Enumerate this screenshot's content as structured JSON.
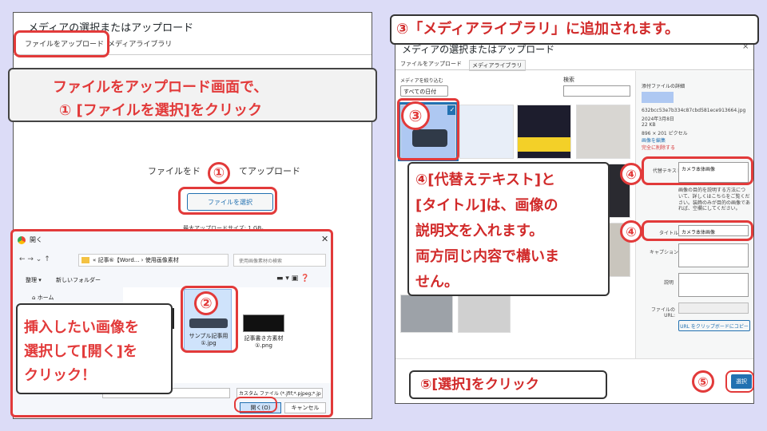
{
  "left": {
    "dialog_title": "メディアの選択またはアップロード",
    "tab_upload": "ファイルをアップロード",
    "tab_library": "メディアライブラリ",
    "callout_line1": "ファイルをアップロード画面で、",
    "callout_line2": "① [ファイルを選択]をクリック",
    "drop_text_a": "ファイルをド",
    "drop_text_b": "てアップロード",
    "step1": "①",
    "select_file_button": "ファイルを選択",
    "max_upload": "最大アップロードサイズ: 1 GB。",
    "open_dialog": {
      "title": "開く",
      "path": "« 記事⑥【Word... › 使用画像素材",
      "search_placeholder": "使用画像素材の検索",
      "organize": "整理 ▾",
      "new_folder": "新しいフォルダー",
      "home": "ホーム",
      "file1": "サンプル記事用 ①.jpg",
      "file2": "記事書き方素材 ①.png",
      "filetype": "カスタム ファイル (*.jfif;*.pjpeg;*.jp",
      "open_button": "開く(O)",
      "cancel_button": "キャンセル"
    },
    "step2": "②",
    "callout_select_l1": "挿入したい画像を",
    "callout_select_l2": "選択して[開く]を",
    "callout_select_l3": "クリック！"
  },
  "right": {
    "banner": "③「メディアライブラリ」に追加されます。",
    "dialog_title": "メディアの選択またはアップロード",
    "close": "×",
    "tab_upload": "ファイルをアップロード",
    "tab_library": "メディアライブラリ",
    "filter_label": "メディアを絞り込む",
    "filter_value": "すべての日付",
    "search_label": "検索",
    "step3": "③",
    "details": {
      "heading": "添付ファイルの詳細",
      "filename": "632bcc53e7b334c87cbd581ece913664.jpg",
      "date": "2024年3月8日",
      "size": "22 KB",
      "dimensions": "896 × 201 ピクセル",
      "edit": "画像を編集",
      "delete": "完全に削除する",
      "alt_label": "代替テキスト",
      "alt_value": "カメラ本体画像",
      "alt_help": "画像の目的を説明する方法について、詳しくはこちらをご覧ください。装飾のみが目的の画像であれば、空欄にしてください。",
      "title_label": "タイトル",
      "title_value": "カメラ本体画像",
      "caption_label": "キャプション",
      "desc_label": "説明",
      "url_label": "ファイルの URL:",
      "copy_url": "URL をクリップボードにコピー"
    },
    "step4a": "④",
    "step4b": "④",
    "callout_alt_l1": "④[代替えテキスト]と",
    "callout_alt_l2": "[タイトル]は、画像の",
    "callout_alt_l3": "説明文を入れます。",
    "callout_alt_l4": "両方同じ内容で構いま",
    "callout_alt_l5": "せん。",
    "callout_select": "⑤[選択]をクリック",
    "step5": "⑤",
    "select_button": "選択"
  }
}
